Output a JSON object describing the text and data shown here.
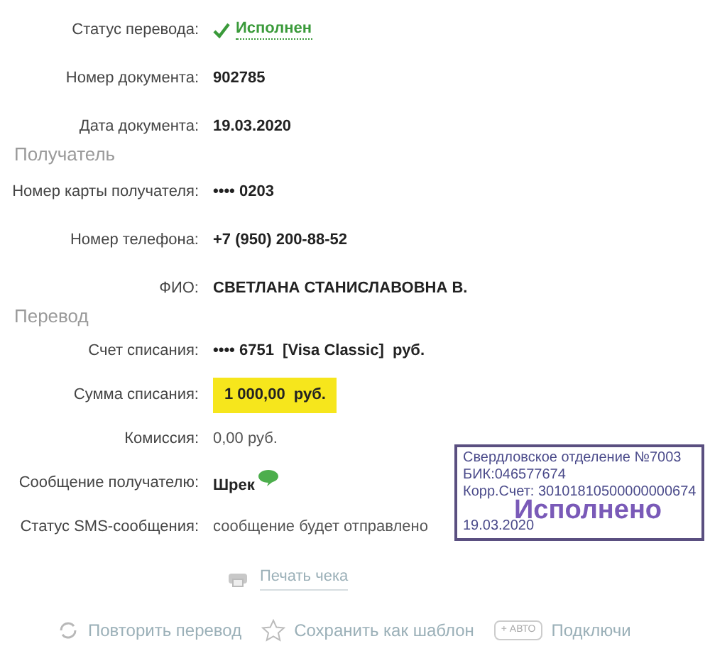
{
  "sections": [
    {
      "rows": [
        {
          "label": "Статус перевода:",
          "value": "Исполнен",
          "kind": "status"
        },
        {
          "label": "Номер документа:",
          "value": "902785",
          "kind": "bold"
        },
        {
          "label": "Дата документа:",
          "value": "19.03.2020",
          "kind": "bold"
        }
      ]
    },
    {
      "title": "Получатель",
      "rows": [
        {
          "label": "Номер карты получателя:",
          "value": "•••• 0203",
          "kind": "bold"
        },
        {
          "label": "Номер телефона:",
          "value": "+7 (950) 200-88-52",
          "kind": "bold"
        },
        {
          "label": "ФИО:",
          "value": "СВЕТЛАНА СТАНИСЛАВОВНА В.",
          "kind": "bold"
        }
      ]
    },
    {
      "title": "Перевод",
      "rows": [
        {
          "label": "Счет списания:",
          "value": "•••• 6751  [Visa Classic]  руб.",
          "kind": "bold"
        },
        {
          "label": "Сумма списания:",
          "value": "1 000,00  руб.",
          "kind": "highlight"
        },
        {
          "label": "Комиссия:",
          "value": "0,00 руб.",
          "kind": "plain"
        },
        {
          "label": "Сообщение получателю:",
          "value": "Шрек",
          "kind": "message"
        },
        {
          "label": "Статус SMS-сообщения:",
          "value": "сообщение будет отправлено",
          "kind": "plain"
        }
      ]
    }
  ],
  "print_link": "Печать чека",
  "actions": [
    {
      "label": "Повторить перевод",
      "kind": "repeat"
    },
    {
      "label": "Сохранить как шаблон",
      "kind": "star"
    },
    {
      "label": "Подключи",
      "kind": "auto",
      "badge": "+ АВТО"
    }
  ],
  "stamp": {
    "lines": [
      "Свердловское отделение №7003",
      "БИК:046577674",
      "Корр.Счет: 30101810500000000674"
    ],
    "status": "Исполнено",
    "date": "19.03.2020"
  }
}
